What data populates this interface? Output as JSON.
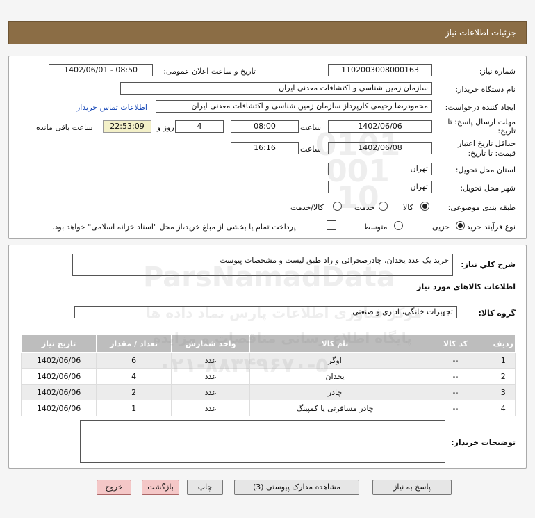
{
  "header": {
    "title": "جزئیات اطلاعات نیاز"
  },
  "form": {
    "need_number_label": "شماره نیاز:",
    "need_number": "1102003008000163",
    "announce_label": "تاریخ و ساعت اعلان عمومی:",
    "announce_value": "1402/06/01 - 08:50",
    "buyer_org_label": "نام دستگاه خریدار:",
    "buyer_org": "سازمان زمین شناسی و اکتشافات معدنی ایران",
    "creator_label": "ایجاد کننده درخواست:",
    "creator": "محمودرضا رحیمی کارپرداز سازمان زمین شناسی و اکتشافات معدنی ایران",
    "contact_link": "اطلاعات تماس خریدار",
    "deadline_label_1": "مهلت ارسال پاسخ: تا",
    "deadline_label_2": "تاریخ:",
    "deadline_date": "1402/06/06",
    "hour_label": "ساعت",
    "deadline_time": "08:00",
    "days_value": "4",
    "days_label": "روز و",
    "remaining_time": "22:53:09",
    "remaining_label": "ساعت باقی مانده",
    "validity_label_1": "حداقل تاریخ اعتبار",
    "validity_label_2": "قیمت: تا تاریخ:",
    "validity_date": "1402/06/08",
    "validity_hour_label": "ساعت",
    "validity_time": "16:16",
    "province_label": "استان محل تحویل:",
    "province": "تهران",
    "city_label": "شهر محل تحویل:",
    "city": "تهران",
    "category_label": "طبقه بندی موضوعی:",
    "category_options": [
      "کالا",
      "خدمت",
      "کالا/خدمت"
    ],
    "category_selected": "کالا",
    "process_label": "نوع فرآیند خرید :",
    "process_options": [
      "جزیی",
      "متوسط"
    ],
    "process_selected": "جزیی",
    "payment_note": "پرداخت تمام یا بخشی از مبلغ خرید،از محل \"اسناد خزانه اسلامی\" خواهد بود."
  },
  "details": {
    "desc_label": "شرح کلي نياز:",
    "desc_value": "خرید یک عدد یخدان، چادرصحرائی و راد طبق لیست و مشخصات پیوست",
    "goods_info_label": "اطلاعات کالاهاي مورد نياز",
    "group_label": "گروه کالا:",
    "group_value": "تجهیزات خانگی، اداری و صنعتی",
    "table_headers": [
      "رديف",
      "کد کالا",
      "نام کالا",
      "واحد شمارش",
      "تعداد / مقدار",
      "تاریخ نیاز"
    ],
    "rows": [
      [
        "1",
        "--",
        "اوگر",
        "عدد",
        "6",
        "1402/06/06"
      ],
      [
        "2",
        "--",
        "یخدان",
        "عدد",
        "4",
        "1402/06/06"
      ],
      [
        "3",
        "--",
        "چادر",
        "عدد",
        "2",
        "1402/06/06"
      ],
      [
        "4",
        "--",
        "چادر مسافرتی یا کمپینگ",
        "عدد",
        "1",
        "1402/06/06"
      ]
    ],
    "buyer_notes_label": "توضیحات خریدار:",
    "buyer_notes": ""
  },
  "buttons": {
    "reply": "پاسخ به نیاز",
    "attachments": "مشاهده مدارک پیوستی (3)",
    "print": "چاپ",
    "back": "بازگشت",
    "exit": "خروج"
  },
  "watermark": {
    "text_main": "ParsNamadData",
    "text_fa": "پایگاه اطلاع رسانی مناقصات و مزایده",
    "text_fa2": "مرکز فناوری اطلاعات پارس نماد داده ها",
    "phone": "۰۲۱-۸۸۳۴۹۶۷۰-۵",
    "stamp": "0101 001 10"
  }
}
